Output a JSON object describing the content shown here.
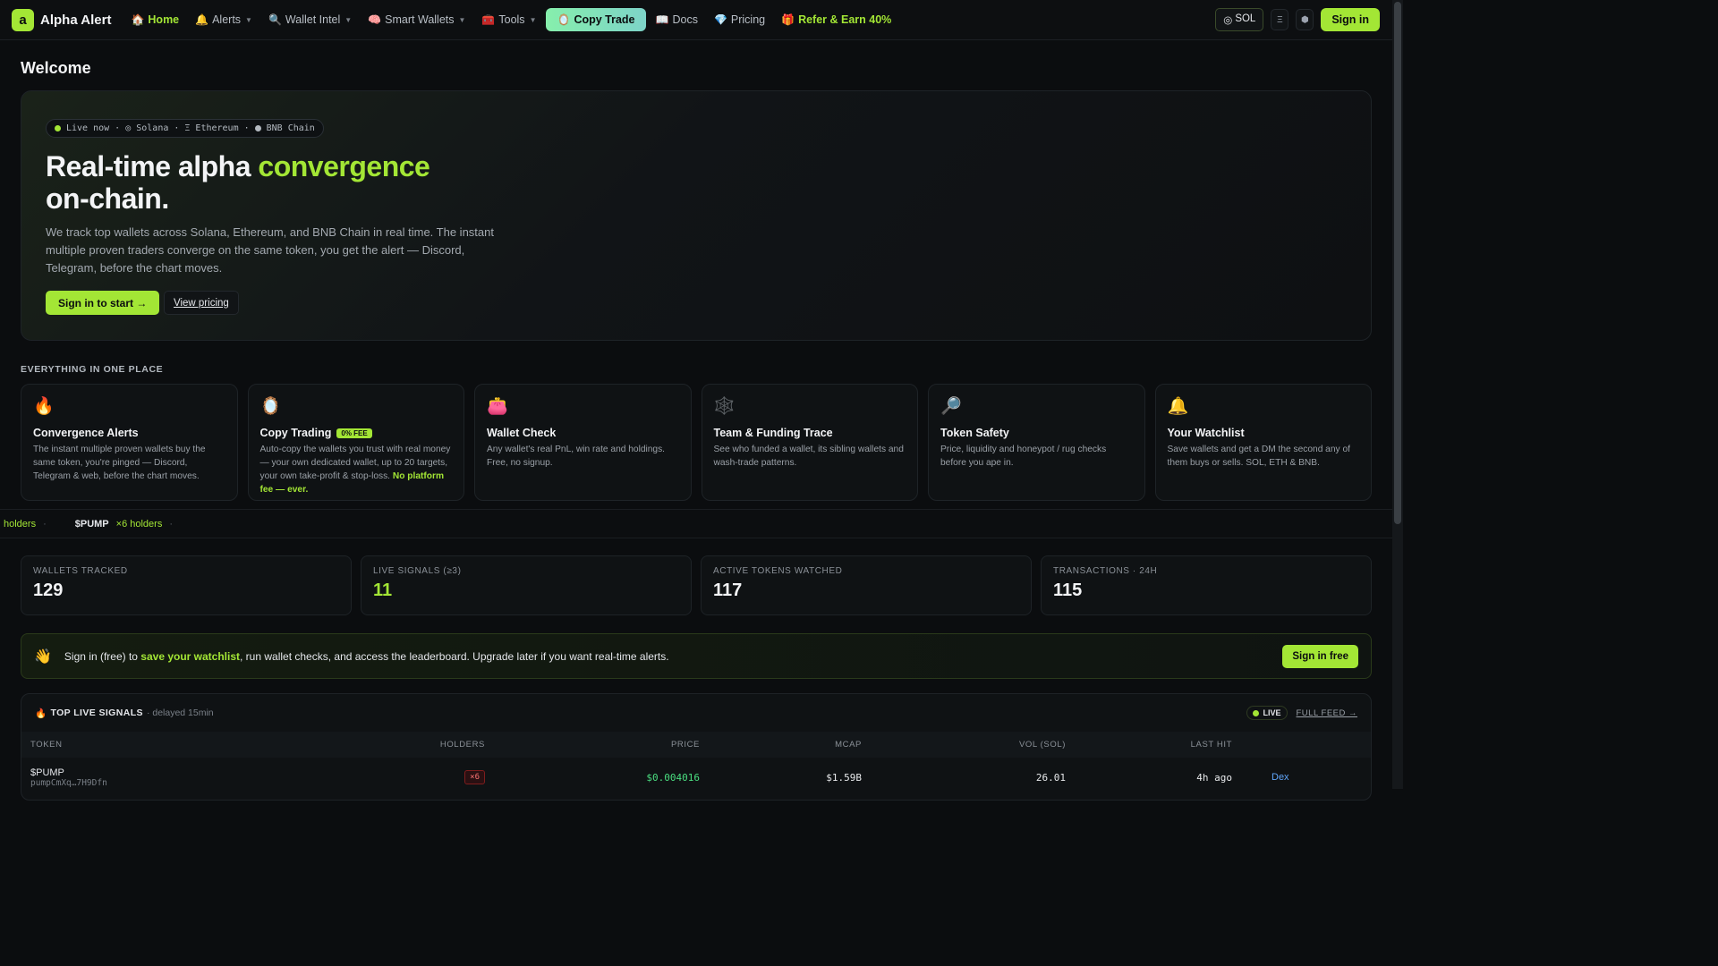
{
  "nav": {
    "logo_letter": "a",
    "brand": "Alpha Alert",
    "items": [
      {
        "icon": "🏠",
        "label": "Home",
        "caret": false
      },
      {
        "icon": "🔔",
        "label": "Alerts",
        "caret": true
      },
      {
        "icon": "🔍",
        "label": "Wallet Intel",
        "caret": true
      },
      {
        "icon": "🧠",
        "label": "Smart Wallets",
        "caret": true
      },
      {
        "icon": "🧰",
        "label": "Tools",
        "caret": true
      },
      {
        "icon": "🪞",
        "label": "Copy Trade",
        "caret": false
      },
      {
        "icon": "📖",
        "label": "Docs",
        "caret": false
      },
      {
        "icon": "💎",
        "label": "Pricing",
        "caret": false
      },
      {
        "icon": "🎁",
        "label": "Refer & Earn 40%",
        "caret": false
      }
    ],
    "chain_icon": "◎",
    "chain_label": "SOL",
    "menu_icon": "Ξ",
    "bnb_icon": "⬢",
    "signin_label": "Sign in"
  },
  "page": {
    "welcome": "Welcome"
  },
  "hero": {
    "pill": {
      "live": "Live now",
      "sep": "·",
      "sol_icon": "◎",
      "sol": "Solana",
      "eth_icon": "Ξ",
      "eth": "Ethereum",
      "bnb": "BNB Chain"
    },
    "title_part1": "Real-time alpha ",
    "title_accent": "convergence",
    "title_part2": "on-chain.",
    "description": "We track top wallets across Solana, Ethereum, and BNB Chain in real time. The instant multiple proven traders converge on the same token, you get the alert — Discord, Telegram, before the chart moves.",
    "cta_primary": "Sign in to start →",
    "cta_secondary": "View pricing"
  },
  "features": {
    "section_label": "EVERYTHING IN ONE PLACE",
    "cards": [
      {
        "icon": "🔥",
        "title": "Convergence Alerts",
        "badge": "",
        "desc": "The instant multiple proven wallets buy the same token, you're pinged — Discord, Telegram & web, before the chart moves.",
        "desc_hl": ""
      },
      {
        "icon": "🪞",
        "title": "Copy Trading",
        "badge": "0% FEE",
        "desc": "Auto-copy the wallets you trust with real money — your own dedicated wallet, up to 20 targets, your own take-profit & stop-loss. ",
        "desc_hl": "No platform fee — ever."
      },
      {
        "icon": "👛",
        "title": "Wallet Check",
        "badge": "",
        "desc": "Any wallet's real PnL, win rate and holdings. Free, no signup.",
        "desc_hl": ""
      },
      {
        "icon": "🕸️",
        "title": "Team & Funding Trace",
        "badge": "",
        "desc": "See who funded a wallet, its sibling wallets and wash-trade patterns.",
        "desc_hl": ""
      },
      {
        "icon": "🔎",
        "title": "Token Safety",
        "badge": "",
        "desc": "Price, liquidity and honeypot / rug checks before you ape in.",
        "desc_hl": ""
      },
      {
        "icon": "🔔",
        "title": "Your Watchlist",
        "badge": "",
        "desc": "Save wallets and get a DM the second any of them buys or sells. SOL, ETH & BNB.",
        "desc_hl": ""
      }
    ]
  },
  "ticker": [
    {
      "symbol": "",
      "count": "holders",
      "sep": "·"
    },
    {
      "symbol": "$PUMP",
      "count": "×6 holders",
      "sep": "·"
    }
  ],
  "stats": [
    {
      "label": "WALLETS TRACKED",
      "value": "129",
      "green": false
    },
    {
      "label": "LIVE SIGNALS (≥3)",
      "value": "11",
      "green": true
    },
    {
      "label": "ACTIVE TOKENS WATCHED",
      "value": "117",
      "green": false
    },
    {
      "label": "TRANSACTIONS · 24H",
      "value": "115",
      "green": false
    }
  ],
  "banner": {
    "icon": "👋",
    "text_before": "Sign in (free) to ",
    "text_hl": "save your watchlist",
    "text_after": ", run wallet checks, and access the leaderboard. Upgrade later if you want real-time alerts.",
    "button": "Sign in free"
  },
  "signals": {
    "icon": "🔥",
    "title": "TOP LIVE SIGNALS",
    "delay": "· delayed 15min",
    "live_label": "LIVE",
    "full_feed": "FULL FEED →",
    "columns": [
      "TOKEN",
      "HOLDERS",
      "PRICE",
      "MCAP",
      "VOL (SOL)",
      "LAST HIT"
    ],
    "rows": [
      {
        "symbol": "$PUMP",
        "address": "pumpCmXq…7H9Dfn",
        "holders": "×6",
        "price": "$0.004016",
        "mcap": "$1.59B",
        "vol": "26.01",
        "last_hit": "4h ago",
        "link": "Dex"
      }
    ]
  }
}
